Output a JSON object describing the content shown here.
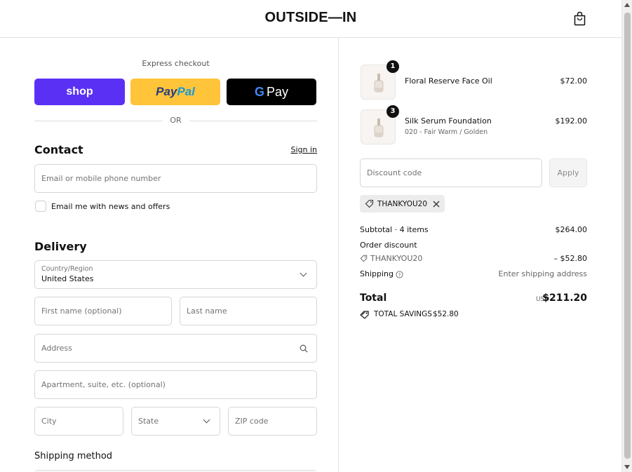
{
  "header": {
    "logo": "OUTSIDE—IN"
  },
  "express": {
    "title": "Express checkout",
    "shop_label": "shop",
    "paypal_label_1": "Pay",
    "paypal_label_2": "Pal",
    "gpay_g": "G",
    "gpay_label": "Pay",
    "or_text": "OR"
  },
  "contact": {
    "heading": "Contact",
    "signin": "Sign in",
    "email_placeholder": "Email or mobile phone number",
    "newsletter_label": "Email me with news and offers"
  },
  "delivery": {
    "heading": "Delivery",
    "country_label": "Country/Region",
    "country_value": "United States",
    "first_name_placeholder": "First name (optional)",
    "last_name_placeholder": "Last name",
    "address_placeholder": "Address",
    "apartment_placeholder": "Apartment, suite, etc. (optional)",
    "city_placeholder": "City",
    "state_placeholder": "State",
    "zip_placeholder": "ZIP code",
    "shipping_method_heading": "Shipping method"
  },
  "cart": {
    "items": [
      {
        "qty": "1",
        "name": "Floral Reserve Face Oil",
        "variant": "",
        "price": "$72.00"
      },
      {
        "qty": "3",
        "name": "Silk Serum Foundation",
        "variant": "020 - Fair Warm / Golden",
        "price": "$192.00"
      }
    ],
    "discount_placeholder": "Discount code",
    "apply_label": "Apply",
    "applied_code": "THANKYOU20"
  },
  "summary": {
    "subtotal_label": "Subtotal · 4 items",
    "subtotal_value": "$264.00",
    "order_discount_label": "Order discount",
    "discount_code": "THANKYOU20",
    "discount_value": "– $52.80",
    "shipping_label": "Shipping",
    "shipping_value": "Enter shipping address",
    "total_label": "Total",
    "currency": "USD",
    "total_value": "$211.20",
    "savings_label": "TOTAL SAVINGS",
    "savings_value": "$52.80"
  },
  "colors": {
    "shop_purple": "#5a31f4",
    "paypal_yellow": "#ffc439",
    "gpay_black": "#000000"
  }
}
